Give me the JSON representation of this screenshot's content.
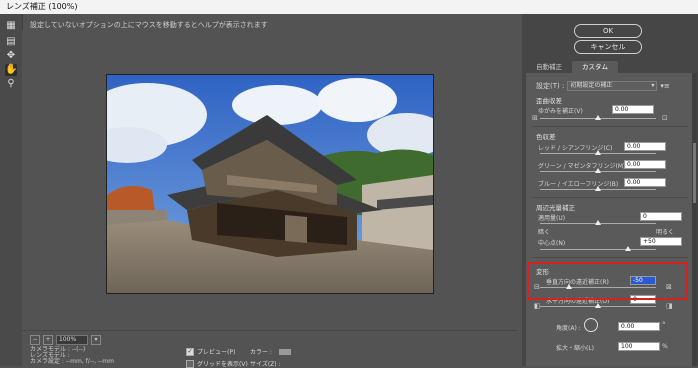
{
  "window": {
    "title": "レンズ補正 (100%)"
  },
  "hint_text": "設定していないオプションの上にマウスを移動するとヘルプが表示されます",
  "buttons": {
    "ok": "OK",
    "cancel": "キャンセル"
  },
  "tabs": [
    {
      "label": "自動補正"
    },
    {
      "label": "カスタム"
    }
  ],
  "custom": {
    "settings_label": "設定(T) :",
    "settings_value": "初期設定の補正",
    "geometric": {
      "title": "歪曲収差",
      "remove_distortion_label": "ゆがみを補正(V)",
      "remove_distortion_value": "0.00"
    },
    "chromatic": {
      "title": "色収差",
      "red_cyan_label": "レッド / シアンフリンジ(C)",
      "red_cyan_value": "0.00",
      "green_magenta_label": "グリーン / マゼンタフリンジ(M)",
      "green_magenta_value": "0.00",
      "blue_yellow_label": "ブルー / イエローフリンジ(B)",
      "blue_yellow_value": "0.00"
    },
    "vignette": {
      "title": "周辺光量補正",
      "amount_label": "適用量(U)",
      "amount_value": "0",
      "dark_label": "暗く",
      "light_label": "明るく",
      "midpoint_label": "中心点(N)",
      "midpoint_value": "+50"
    },
    "transform": {
      "title": "変形",
      "vertical_label": "垂直方向の遠近補正(R)",
      "vertical_value": "-50",
      "horizontal_label": "水平方向の遠近補正(O)",
      "horizontal_value": "0",
      "angle_label": "角度(A) :",
      "angle_value": "0.00",
      "scale_label": "拡大・縮小(L)",
      "scale_value": "100",
      "scale_unit": "%"
    }
  },
  "bottom": {
    "zoom_value": "100%",
    "camera_model": "カメラモデル : --(--)",
    "lens_model": "レンズモデル :",
    "camera_settings": "カメラ設定 : --mm, f/--, --mm",
    "preview_label": "プレビュー(P)",
    "grid_label": "グリッドを表示(V)",
    "color_label": "カラー :",
    "size_label": "サイズ(Z) :"
  },
  "colors": {
    "highlight": "#d82020",
    "panel": "#5a5a5a",
    "selected": "#2a5ad0"
  }
}
